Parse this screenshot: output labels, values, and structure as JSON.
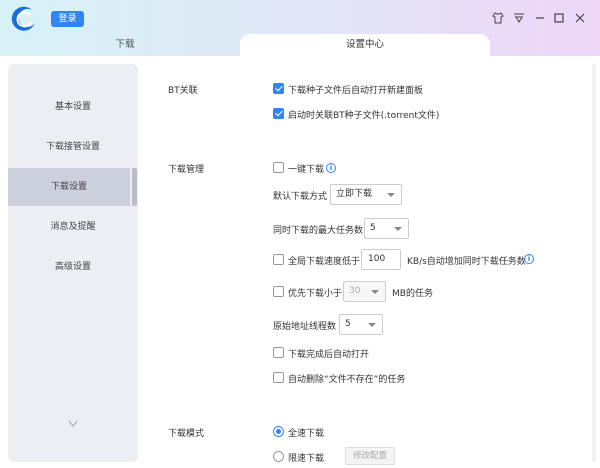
{
  "header": {
    "login_label": "登录",
    "accent": "#2f86f6",
    "icons": [
      "skin-icon",
      "menu-icon",
      "minimize-icon",
      "maximize-icon",
      "close-icon"
    ]
  },
  "tabs": {
    "download": "下载",
    "settings": "设置中心"
  },
  "sidebar": {
    "items": [
      {
        "label": "基本设置"
      },
      {
        "label": "下载接管设置"
      },
      {
        "label": "下载设置"
      },
      {
        "label": "消息及提醒"
      },
      {
        "label": "高级设置"
      }
    ],
    "active_index": 2
  },
  "bt": {
    "section": "BT关联",
    "auto_open_panel": "下载种子文件后自动打开新建面板",
    "associate_torrent": "启动时关联BT种子文件(.torrent文件)"
  },
  "manage": {
    "section": "下载管理",
    "one_click": "一键下载",
    "default_mode_label": "默认下载方式",
    "default_mode_value": "立即下载",
    "max_tasks_label": "同时下载的最大任务数",
    "max_tasks_value": "5",
    "speed_prefix": "全局下载速度低于",
    "speed_value": "100",
    "speed_suffix": "KB/s自动增加同时下载任务数",
    "priority_prefix": "优先下载小于",
    "priority_value": "30",
    "priority_suffix": "MB的任务",
    "threads_label": "原始地址线程数",
    "threads_value": "5",
    "open_after": "下载完成后自动打开",
    "auto_delete": "自动删除“文件不存在”的任务"
  },
  "mode": {
    "section": "下载模式",
    "full_speed": "全速下载",
    "limited": "限速下载",
    "modify": "修改配置"
  }
}
